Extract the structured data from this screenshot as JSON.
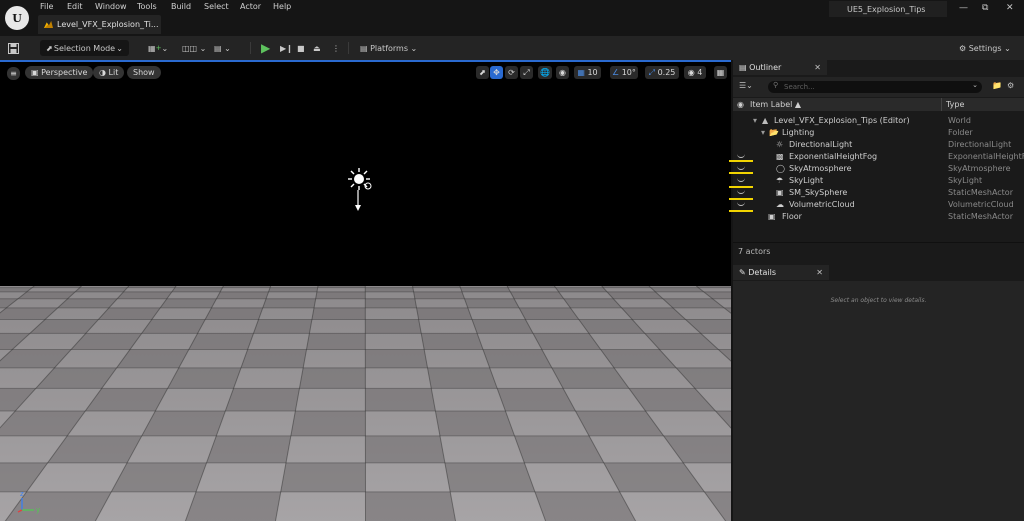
{
  "menu": {
    "items": [
      "File",
      "Edit",
      "Window",
      "Tools",
      "Build",
      "Select",
      "Actor",
      "Help"
    ],
    "level_tab": "Level_VFX_Explosion_Ti...",
    "project_name": "UE5_Explosion_Tips"
  },
  "toolbar": {
    "selection_mode": "Selection Mode",
    "platforms": "Platforms",
    "settings": "Settings"
  },
  "viewport": {
    "perspective": "Perspective",
    "lit": "Lit",
    "show": "Show",
    "grid_size": "10",
    "rotation_snap": "10°",
    "scale_snap": "0.25",
    "camera_speed": "4"
  },
  "outliner": {
    "tab_title": "Outliner",
    "search_placeholder": "Search...",
    "col_label": "Item Label",
    "col_type": "Type",
    "rows": [
      {
        "label": "Level_VFX_Explosion_Tips (Editor)",
        "type": "World"
      },
      {
        "label": "Lighting",
        "type": "Folder"
      },
      {
        "label": "DirectionalLight",
        "type": "DirectionalLight"
      },
      {
        "label": "ExponentialHeightFog",
        "type": "ExponentialHeightFog"
      },
      {
        "label": "SkyAtmosphere",
        "type": "SkyAtmosphere"
      },
      {
        "label": "SkyLight",
        "type": "SkyLight"
      },
      {
        "label": "SM_SkySphere",
        "type": "StaticMeshActor"
      },
      {
        "label": "VolumetricCloud",
        "type": "VolumetricCloud"
      },
      {
        "label": "Floor",
        "type": "StaticMeshActor"
      }
    ],
    "actor_count": "7 actors"
  },
  "details": {
    "tab_title": "Details",
    "empty_text": "Select an object to view details."
  },
  "colors": {
    "accent_blue": "#2a6ad0",
    "highlight_yellow": "#f2d400",
    "play_green": "#5ec25e"
  }
}
